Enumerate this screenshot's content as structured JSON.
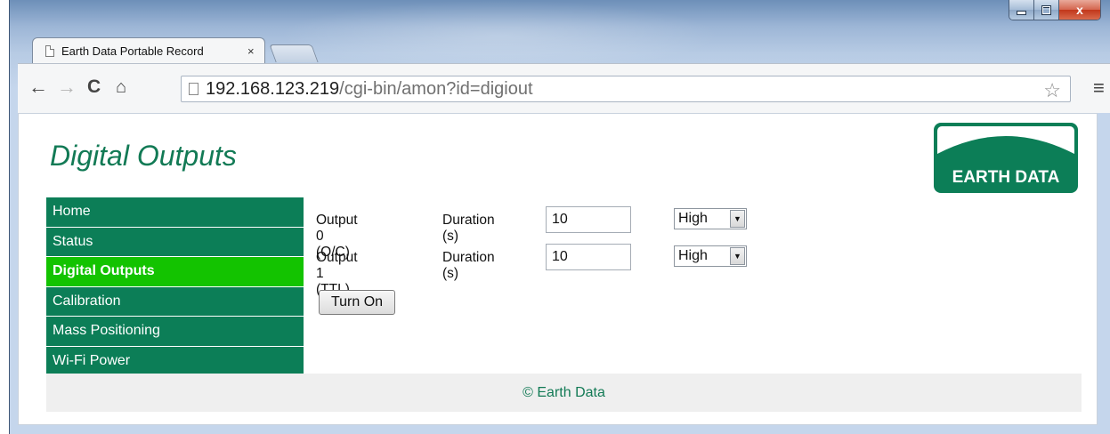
{
  "window": {
    "controls": {
      "minimize": "minimize",
      "maximize": "maximize",
      "close": "x"
    }
  },
  "tab": {
    "title": "Earth Data Portable Record",
    "close": "×"
  },
  "toolbar": {
    "back": "←",
    "forward": "→",
    "reload": "C",
    "home": "⌂",
    "url_host": "192.168.123.219",
    "url_path": "/cgi-bin/amon?id=digiout",
    "star": "☆",
    "menu": "≡"
  },
  "page": {
    "title": "Digital Outputs",
    "logo_text": "EARTH DATA"
  },
  "sidebar": {
    "items": [
      {
        "label": "Home",
        "active": false
      },
      {
        "label": "Status",
        "active": false
      },
      {
        "label": "Digital Outputs",
        "active": true
      },
      {
        "label": "Calibration",
        "active": false
      },
      {
        "label": "Mass Positioning",
        "active": false
      },
      {
        "label": "Wi-Fi Power",
        "active": false
      }
    ]
  },
  "outputs": [
    {
      "label": "Output 0 (O/C)",
      "duration_label": "Duration (s)",
      "duration": "10",
      "level": "High"
    },
    {
      "label": "Output 1 (TTL)",
      "duration_label": "Duration (s)",
      "duration": "10",
      "level": "High"
    }
  ],
  "turn_on_label": "Turn On",
  "footer": {
    "text": "© Earth Data"
  },
  "colors": {
    "brand_green": "#0c7e57",
    "active_green": "#13c300",
    "title_green": "#127a55"
  }
}
